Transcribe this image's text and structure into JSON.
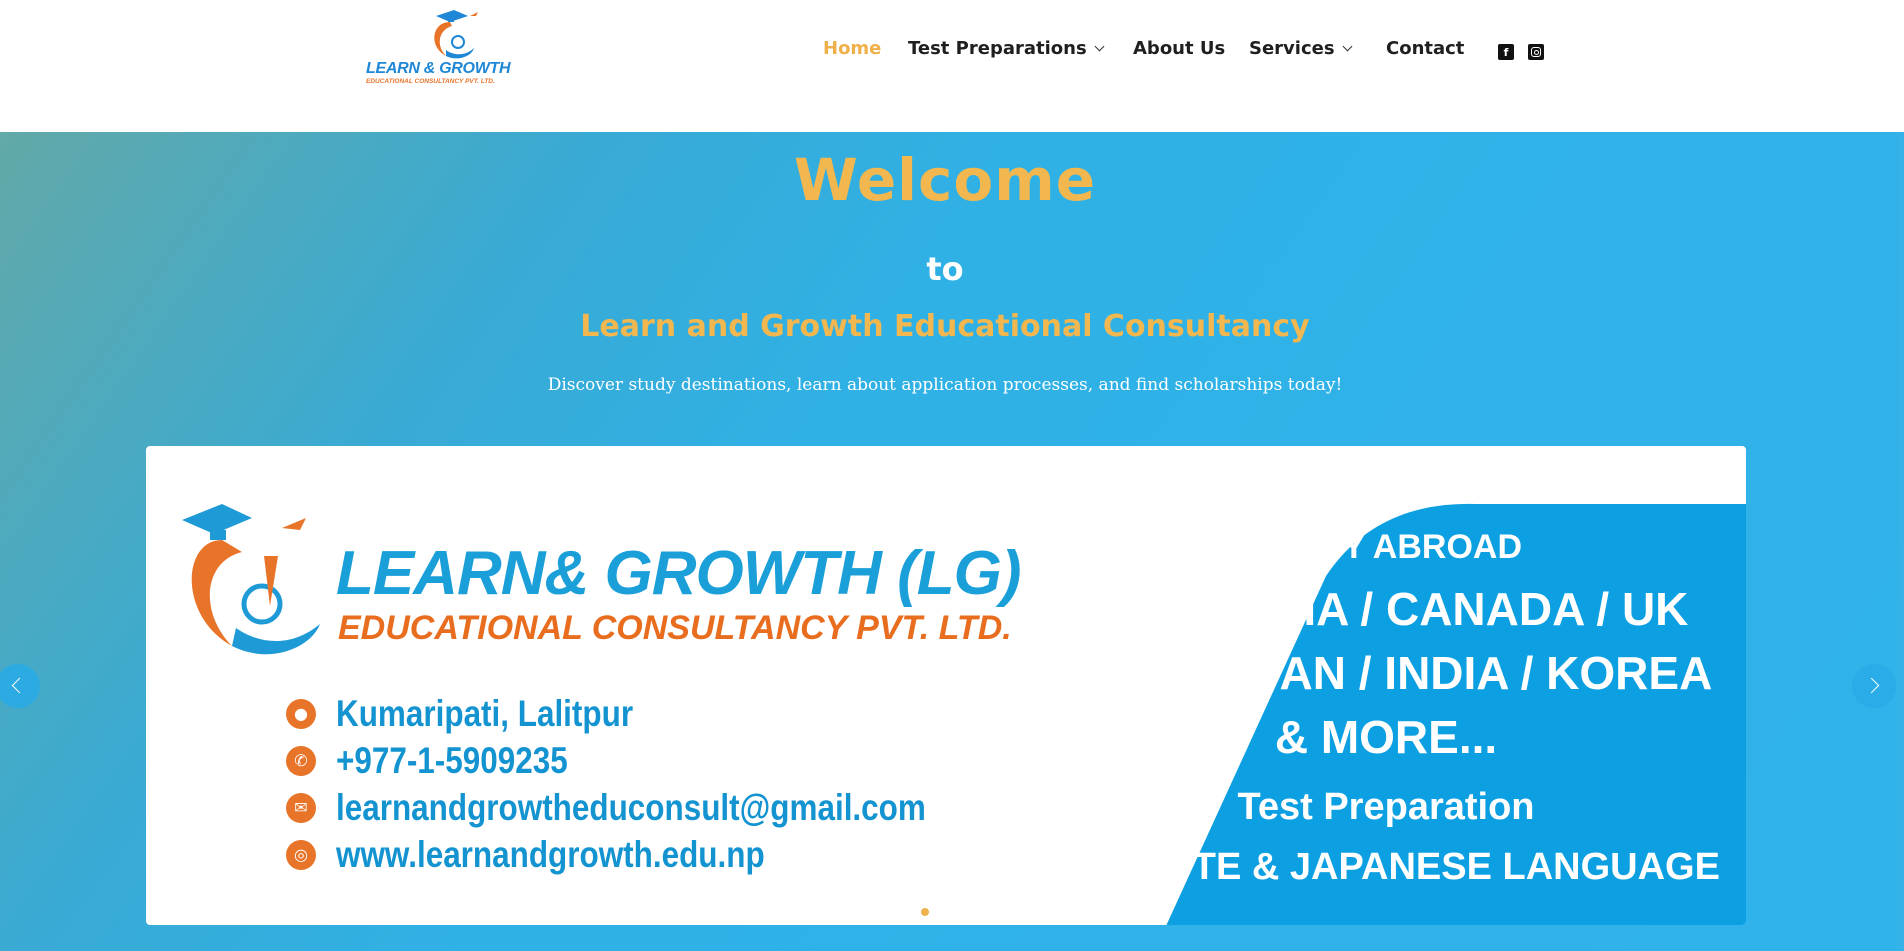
{
  "header": {
    "logo": {
      "line1": "LEARN & GROWTH",
      "line2": "EDUCATIONAL CONSULTANCY PVT. LTD."
    },
    "nav": [
      {
        "label": "Home",
        "active": true
      },
      {
        "label": "Test Preparations",
        "dropdown": true
      },
      {
        "label": "About Us"
      },
      {
        "label": "Services",
        "dropdown": true
      },
      {
        "label": "Contact"
      }
    ],
    "social": [
      "facebook-icon",
      "instagram-icon"
    ]
  },
  "hero": {
    "welcome": "Welcome",
    "to": "to",
    "company": "Learn and Growth Educational Consultancy",
    "tagline": "Discover study destinations, learn about application processes, and find scholarships today!"
  },
  "slider": {
    "banner": {
      "title": "LEARN& GROWTH (LG)",
      "subtitle": "EDUCATIONAL CONSULTANCY PVT. LTD.",
      "address": "Kumaripati, Lalitpur",
      "phone": "+977-1-5909235",
      "email": "learnandgrowtheduconsult@gmail.com",
      "website": "www.learnandgrowth.edu.np",
      "study_abroad": "STUDY ABROAD",
      "countries1": "AUSTRALIA / CANADA / UK",
      "countries2": "USA / JAPAN / INDIA / KOREA",
      "more": "& MORE...",
      "test_prep": "Test Preparation",
      "tests": "IELTS/PTE & JAPANESE LANGUAGE"
    },
    "slide_count": 3,
    "active_slide": 1
  },
  "colors": {
    "accent": "#f3b74f",
    "hero_blue": "#30b3ea",
    "brand_blue": "#1b9fd9",
    "brand_orange": "#e8742a"
  }
}
